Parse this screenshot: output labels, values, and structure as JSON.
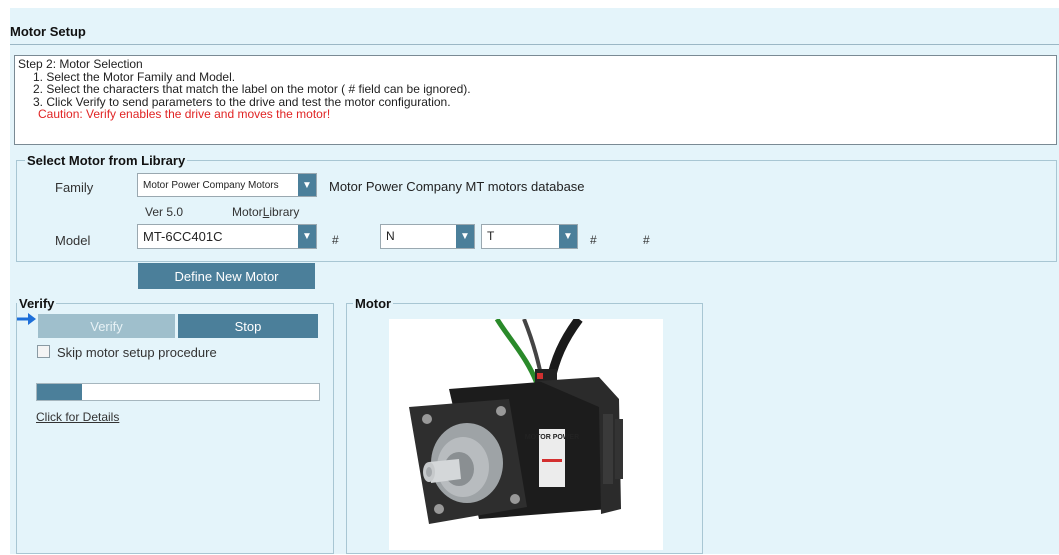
{
  "header": {
    "title": "Motor Setup"
  },
  "instructions": {
    "step": "Step 2: Motor Selection",
    "line1": "1. Select the Motor Family and Model.",
    "line2": "2. Select the characters that match the label on the motor ( # field can be ignored).",
    "line3": "3. Click Verify to send parameters to the drive and test the motor configuration.",
    "caution": "Caution: Verify enables the drive and moves the motor!"
  },
  "library": {
    "legend": "Select Motor from Library",
    "family_label": "Family",
    "family_value": "Motor Power Company Motors",
    "family_description": "Motor Power Company MT motors database",
    "version": "Ver 5.0",
    "motor_library_prefix": "Motor",
    "motor_library_underlined": "L",
    "motor_library_suffix": "ibrary",
    "model_label": "Model",
    "model_value": "MT-6CC401C",
    "hash1": "#",
    "option_n": "N",
    "option_t": "T",
    "hash2": "#",
    "hash3": "#",
    "define_button": "Define New Motor"
  },
  "verify": {
    "legend": "Verify",
    "verify_button": "Verify",
    "stop_button": "Stop",
    "skip_label": "Skip motor setup procedure",
    "skip_checked": false,
    "progress": 0.16,
    "details_link": "Click for Details"
  },
  "motor": {
    "legend": "Motor",
    "brand_text": "MOTOR POWER"
  },
  "colors": {
    "panel_bg": "#e4f4fa",
    "button": "#4b7f9a",
    "button_disabled": "#9fbfcc",
    "caution": "#e02424",
    "arrow": "#1e6fd9"
  }
}
